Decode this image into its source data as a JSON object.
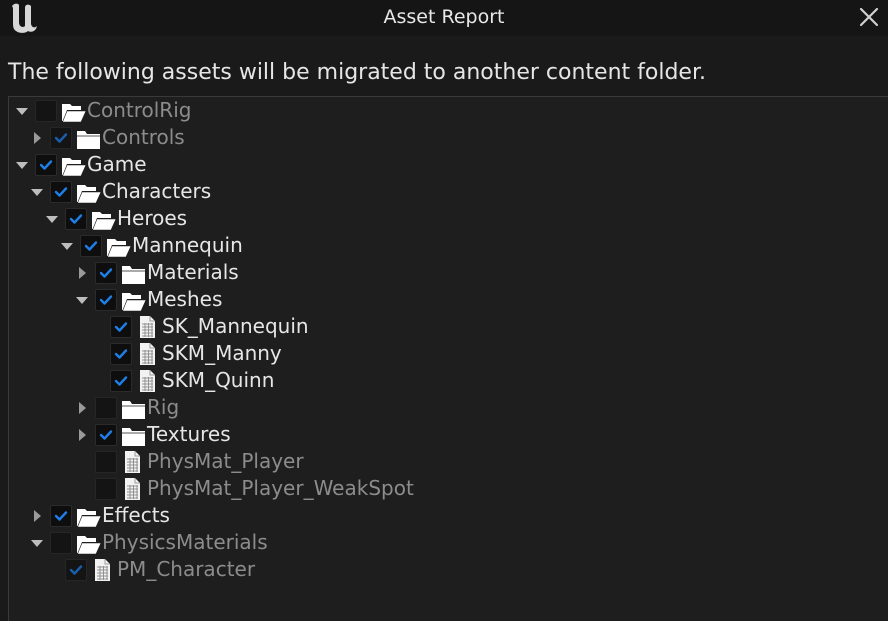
{
  "window": {
    "title": "Asset Report"
  },
  "message": "The following assets will be migrated to another content folder.",
  "colors": {
    "accent": "#1f7fe8",
    "background": "#1a1a1a",
    "text": "#e6e6e6",
    "dimText": "#8c8c8c"
  },
  "tree": [
    {
      "label": "ControlRig",
      "depth": 0,
      "expander": "expanded",
      "icon": "folder-open-icon",
      "checked": false,
      "dim": true
    },
    {
      "label": "Controls",
      "depth": 1,
      "expander": "collapsed",
      "icon": "folder-closed-icon",
      "checked": true,
      "dim": true
    },
    {
      "label": "Game",
      "depth": 0,
      "expander": "expanded",
      "icon": "folder-open-icon",
      "checked": true,
      "dim": false
    },
    {
      "label": "Characters",
      "depth": 1,
      "expander": "expanded",
      "icon": "folder-open-icon",
      "checked": true,
      "dim": false
    },
    {
      "label": "Heroes",
      "depth": 2,
      "expander": "expanded",
      "icon": "folder-open-icon",
      "checked": true,
      "dim": false
    },
    {
      "label": "Mannequin",
      "depth": 3,
      "expander": "expanded",
      "icon": "folder-open-icon",
      "checked": true,
      "dim": false
    },
    {
      "label": "Materials",
      "depth": 4,
      "expander": "collapsed",
      "icon": "folder-closed-icon",
      "checked": true,
      "dim": false
    },
    {
      "label": "Meshes",
      "depth": 4,
      "expander": "expanded",
      "icon": "folder-open-icon",
      "checked": true,
      "dim": false
    },
    {
      "label": "SK_Mannequin",
      "depth": 5,
      "expander": "none",
      "icon": "asset-file-icon",
      "checked": true,
      "dim": false
    },
    {
      "label": "SKM_Manny",
      "depth": 5,
      "expander": "none",
      "icon": "asset-file-icon",
      "checked": true,
      "dim": false
    },
    {
      "label": "SKM_Quinn",
      "depth": 5,
      "expander": "none",
      "icon": "asset-file-icon",
      "checked": true,
      "dim": false
    },
    {
      "label": "Rig",
      "depth": 4,
      "expander": "collapsed",
      "icon": "folder-closed-icon",
      "checked": false,
      "dim": true
    },
    {
      "label": "Textures",
      "depth": 4,
      "expander": "collapsed",
      "icon": "folder-closed-icon",
      "checked": true,
      "dim": false
    },
    {
      "label": "PhysMat_Player",
      "depth": 4,
      "expander": "none",
      "icon": "asset-file-icon",
      "checked": false,
      "dim": true
    },
    {
      "label": "PhysMat_Player_WeakSpot",
      "depth": 4,
      "expander": "none",
      "icon": "asset-file-icon",
      "checked": false,
      "dim": true
    },
    {
      "label": "Effects",
      "depth": 1,
      "expander": "collapsed",
      "icon": "folder-open-icon",
      "checked": true,
      "dim": false
    },
    {
      "label": "PhysicsMaterials",
      "depth": 1,
      "expander": "expanded",
      "icon": "folder-open-icon",
      "checked": false,
      "dim": true
    },
    {
      "label": "PM_Character",
      "depth": 2,
      "expander": "none",
      "icon": "asset-file-icon",
      "checked": true,
      "dim": true
    }
  ]
}
